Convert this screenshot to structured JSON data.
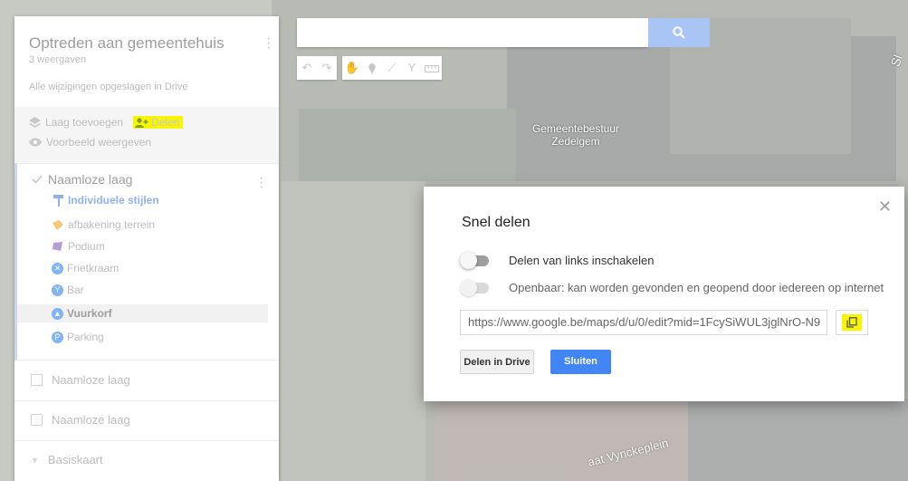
{
  "map": {
    "building_label": "Gemeentebestuur\nZedelgem",
    "street_label": "aat Vynckeplein",
    "corner_label": "Sl"
  },
  "panel": {
    "title": "Optreden aan gemeentehuis",
    "subtitle": "3 weergaven",
    "saved_status": "Alle wijzigingen opgeslagen in Drive",
    "add_layer": "Laag toevoegen",
    "share": "Delen",
    "preview": "Voorbeeld weergeven",
    "layer": {
      "name": "Naamloze laag",
      "styles": "Individuele stijlen",
      "items": [
        {
          "label": "afbakening terrein",
          "icon": "polygon-icon",
          "color": "#f7c873"
        },
        {
          "label": "Podium",
          "icon": "polygon-icon",
          "color": "#b39ddb"
        },
        {
          "label": "Frietkraam",
          "icon": "x-marker-icon",
          "color": "#81b4f5"
        },
        {
          "label": "Bar",
          "icon": "cocktail-marker-icon",
          "color": "#81b4f5"
        },
        {
          "label": "Vuurkorf",
          "icon": "fire-marker-icon",
          "color": "#81b4f5"
        },
        {
          "label": "Parking",
          "icon": "parking-marker-icon",
          "color": "#81b4f5"
        }
      ]
    },
    "layer2": "Naamloze laag",
    "layer3": "Naamloze laag",
    "basemap": "Basiskaart"
  },
  "search": {
    "placeholder": ""
  },
  "dialog": {
    "title": "Snel delen",
    "toggle_links": "Delen van links inschakelen",
    "toggle_public": "Openbaar: kan worden gevonden en geopend door iedereen op internet",
    "url": "https://www.google.be/maps/d/u/0/edit?mid=1FcySiWUL3jglNrO-N9",
    "share_drive_button": "Delen in Drive",
    "close_button": "Sluiten"
  },
  "colors": {
    "highlight": "#f7f500",
    "primary_button": "#4285f4",
    "accent_text": "#8fb2f0"
  }
}
